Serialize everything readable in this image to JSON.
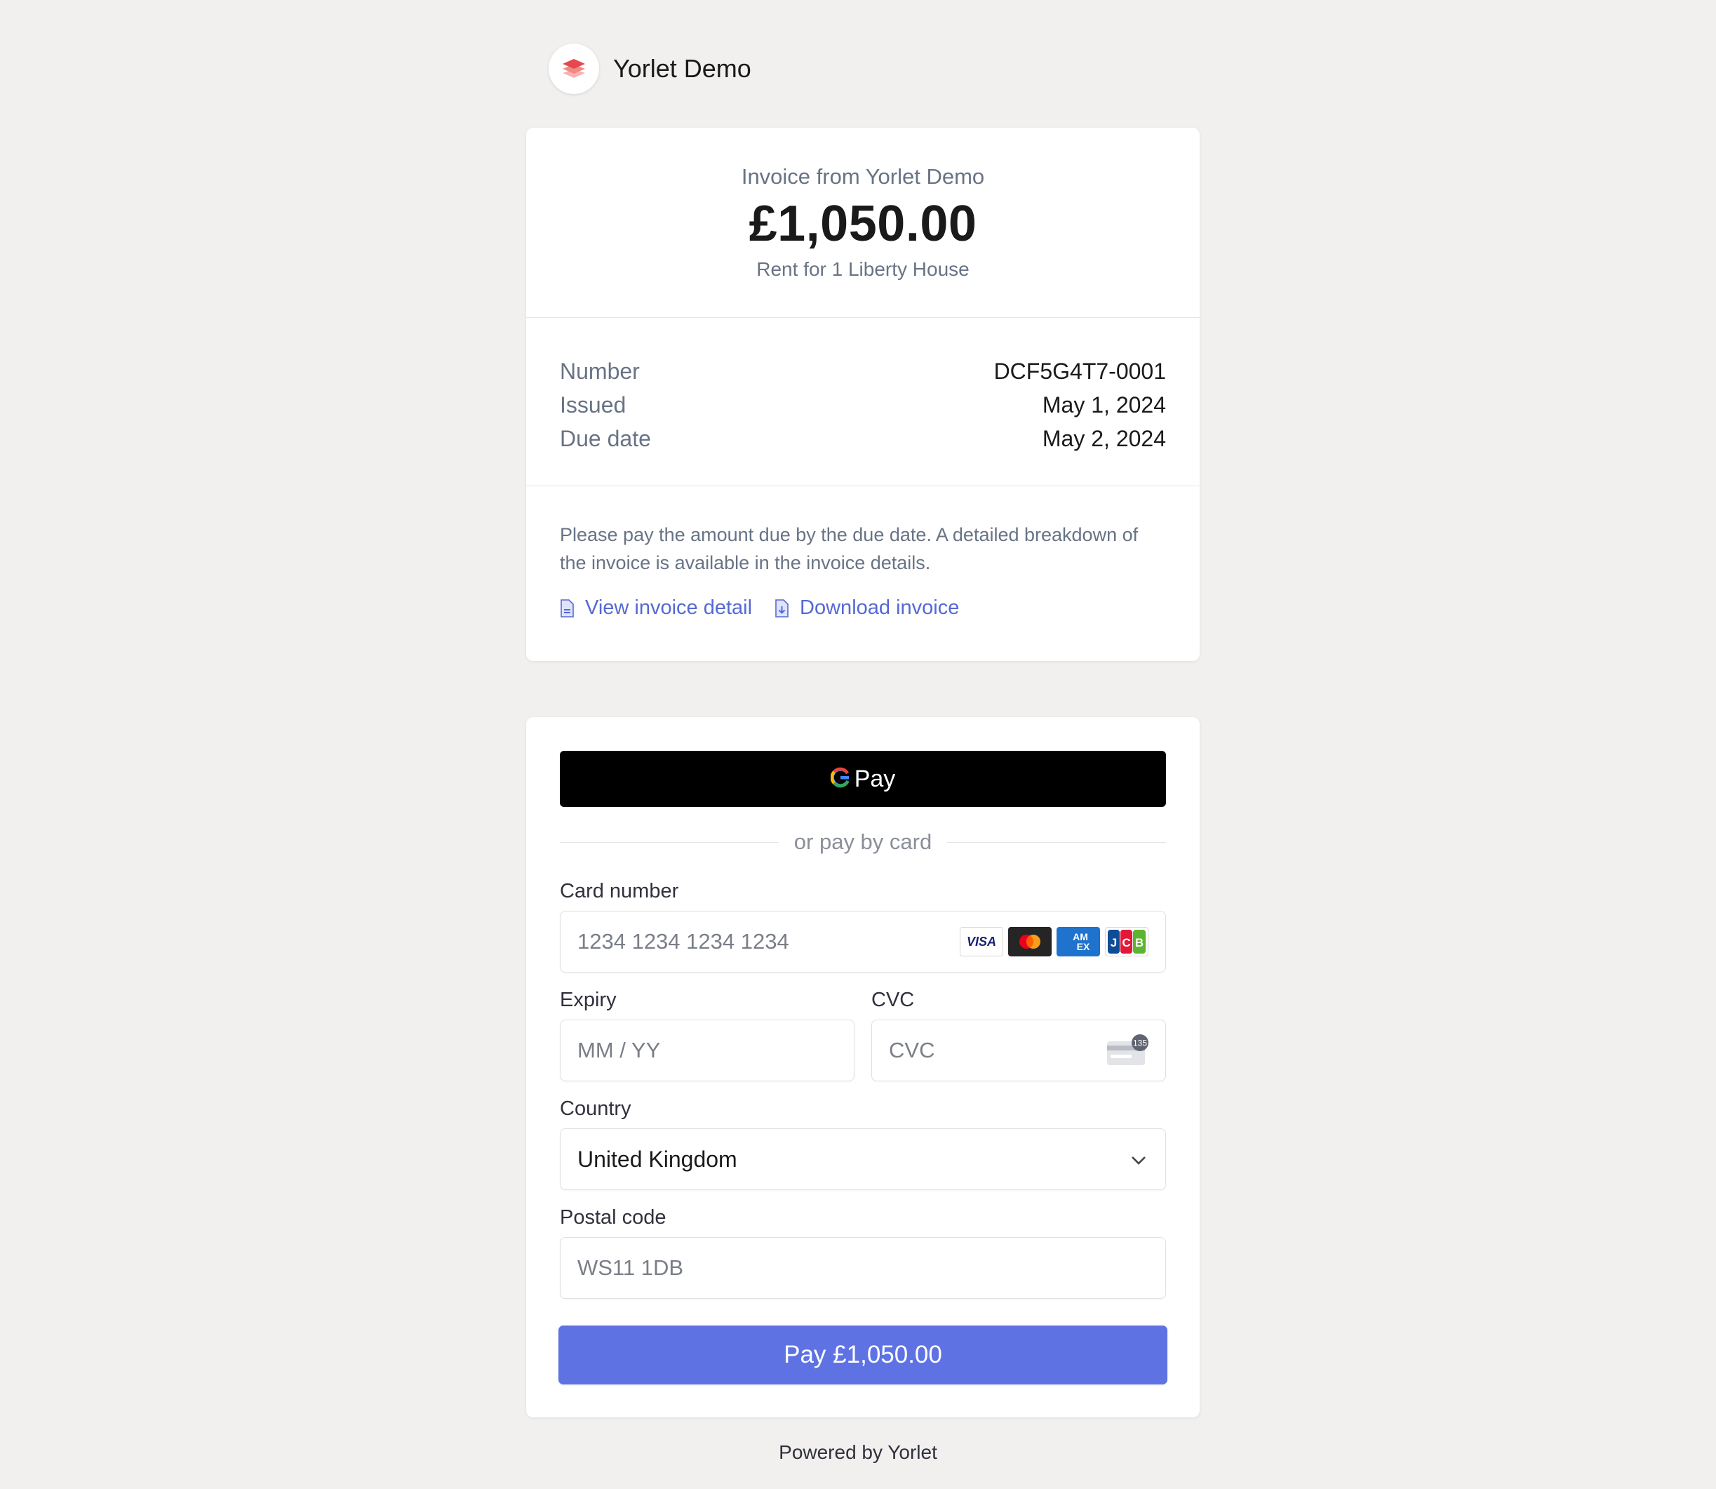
{
  "merchant": {
    "name": "Yorlet Demo",
    "logo_icon": "stacked-layers-icon"
  },
  "invoice": {
    "from_label": "Invoice from Yorlet Demo",
    "amount": "£1,050.00",
    "description": "Rent for 1 Liberty House",
    "meta": [
      {
        "key": "Number",
        "value": "DCF5G4T7-0001"
      },
      {
        "key": "Issued",
        "value": "May 1, 2024"
      },
      {
        "key": "Due date",
        "value": "May 2, 2024"
      }
    ],
    "note": "Please pay the amount due by the due date. A detailed breakdown of the invoice is available in the invoice details.",
    "links": {
      "view": {
        "label": "View invoice detail",
        "icon": "document-icon"
      },
      "download": {
        "label": "Download invoice",
        "icon": "document-download-icon"
      }
    }
  },
  "payment": {
    "gpay_label": "Pay",
    "divider_text": "or pay by card",
    "card_number": {
      "label": "Card number",
      "placeholder": "1234 1234 1234 1234",
      "brands": [
        "visa",
        "mastercard",
        "amex",
        "jcb"
      ]
    },
    "expiry": {
      "label": "Expiry",
      "placeholder": "MM / YY"
    },
    "cvc": {
      "label": "CVC",
      "placeholder": "CVC",
      "badge": "135"
    },
    "country": {
      "label": "Country",
      "value": "United Kingdom"
    },
    "postal": {
      "label": "Postal code",
      "placeholder": "WS11 1DB"
    },
    "pay_button": "Pay £1,050.00"
  },
  "footer": {
    "powered_by": "Powered by Yorlet"
  },
  "colors": {
    "accent": "#5e72e4",
    "link": "#5469d4",
    "muted": "#687385",
    "background": "#f1f0ee"
  }
}
